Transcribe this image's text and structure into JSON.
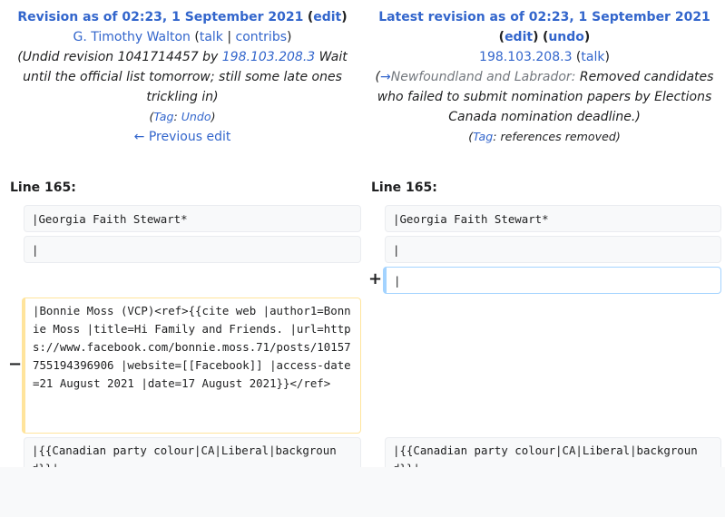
{
  "left": {
    "title": "Revision as of 02:23, 1 September 2021",
    "edit_label": "edit",
    "user": "G. Timothy Walton",
    "talk_label": "talk",
    "contribs_label": "contribs",
    "summary_prefix": "Undid revision 1041714457 by",
    "summary_user": "198.103.208.3",
    "summary_text": "Wait until the official list tomorrow; still some late ones trickling in",
    "tag_label": "Tag",
    "tag_value": "Undo",
    "prev_edit": "← Previous edit",
    "line_label": "Line 165:"
  },
  "right": {
    "title": "Latest revision as of 02:23, 1 September 2021",
    "edit_label": "edit",
    "undo_label": "undo",
    "user": "198.103.208.3",
    "talk_label": "talk",
    "summary_arrow": "→",
    "summary_section": "Newfoundland and Labrador",
    "summary_text": "Removed candidates who failed to submit nomination papers by Elections Canada nomination deadline.",
    "tag_label": "Tag",
    "tag_value": "references removed",
    "line_label": "Line 165:"
  },
  "diff": {
    "ctx1": "|Georgia Faith Stewart*",
    "ctx2": "|",
    "added": "|",
    "removed": "|Bonnie Moss (VCP)<ref>{{cite web |author1=Bonnie Moss |title=Hi Family and Friends. |url=https://www.facebook.com/bonnie.moss.71/posts/10157755194396906 |website=[[Facebook]] |access-date=21 August 2021 |date=17 August 2021}}</ref>",
    "ctx3": "|{{Canadian party colour|CA|Liberal|background}}|",
    "plus": "+",
    "minus": "−"
  }
}
